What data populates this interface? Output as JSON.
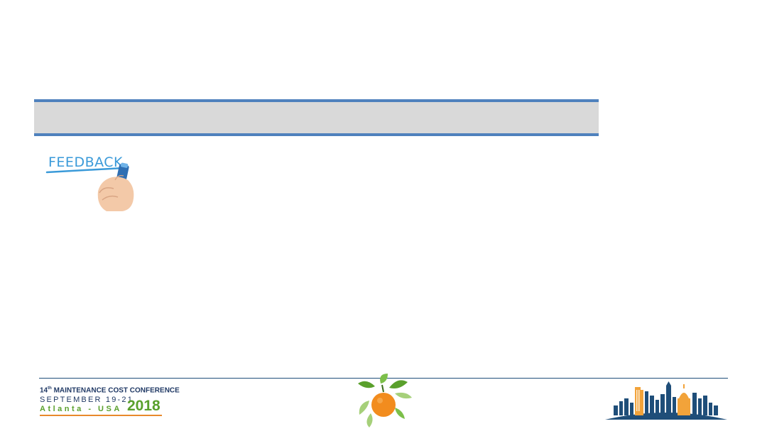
{
  "slide": {
    "title": ""
  },
  "feedback_image": {
    "word": "FEEDBACK",
    "accent": "#3a9ad9"
  },
  "footer": {
    "conference": {
      "ordinal": "14",
      "ordinal_suffix": "th",
      "name": "MAINTENANCE COST CONFERENCE",
      "dates": "SEPTEMBER 19-21",
      "location": "Atlanta - USA",
      "year": "2018"
    },
    "colors": {
      "navy": "#1f3864",
      "green": "#5aa02c",
      "orange": "#e8892b",
      "blue": "#4f81bd"
    }
  }
}
